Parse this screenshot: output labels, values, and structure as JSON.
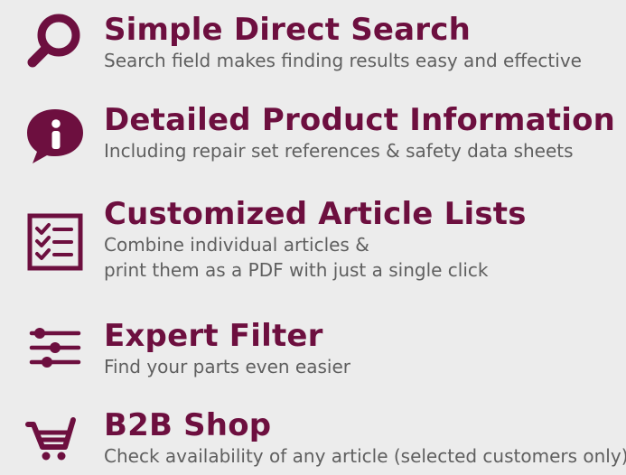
{
  "colors": {
    "brand": "#6d0f3f",
    "text": "#5f5f5f",
    "background": "#ececec"
  },
  "features": [
    {
      "icon": "search-icon",
      "title": "Simple Direct Search",
      "description": "Search field makes finding results easy and effective"
    },
    {
      "icon": "info-speech-bubble-icon",
      "title": "Detailed Product Information",
      "description": "Including repair set references & safety data sheets"
    },
    {
      "icon": "checklist-icon",
      "title": "Customized Article Lists",
      "description_lines": [
        "Combine individual articles &",
        "print them as a PDF with just a single click"
      ]
    },
    {
      "icon": "filter-sliders-icon",
      "title": "Expert Filter",
      "description": "Find your parts even easier"
    },
    {
      "icon": "shopping-cart-icon",
      "title": "B2B Shop",
      "description": "Check availability of any article (selected customers only)"
    }
  ]
}
